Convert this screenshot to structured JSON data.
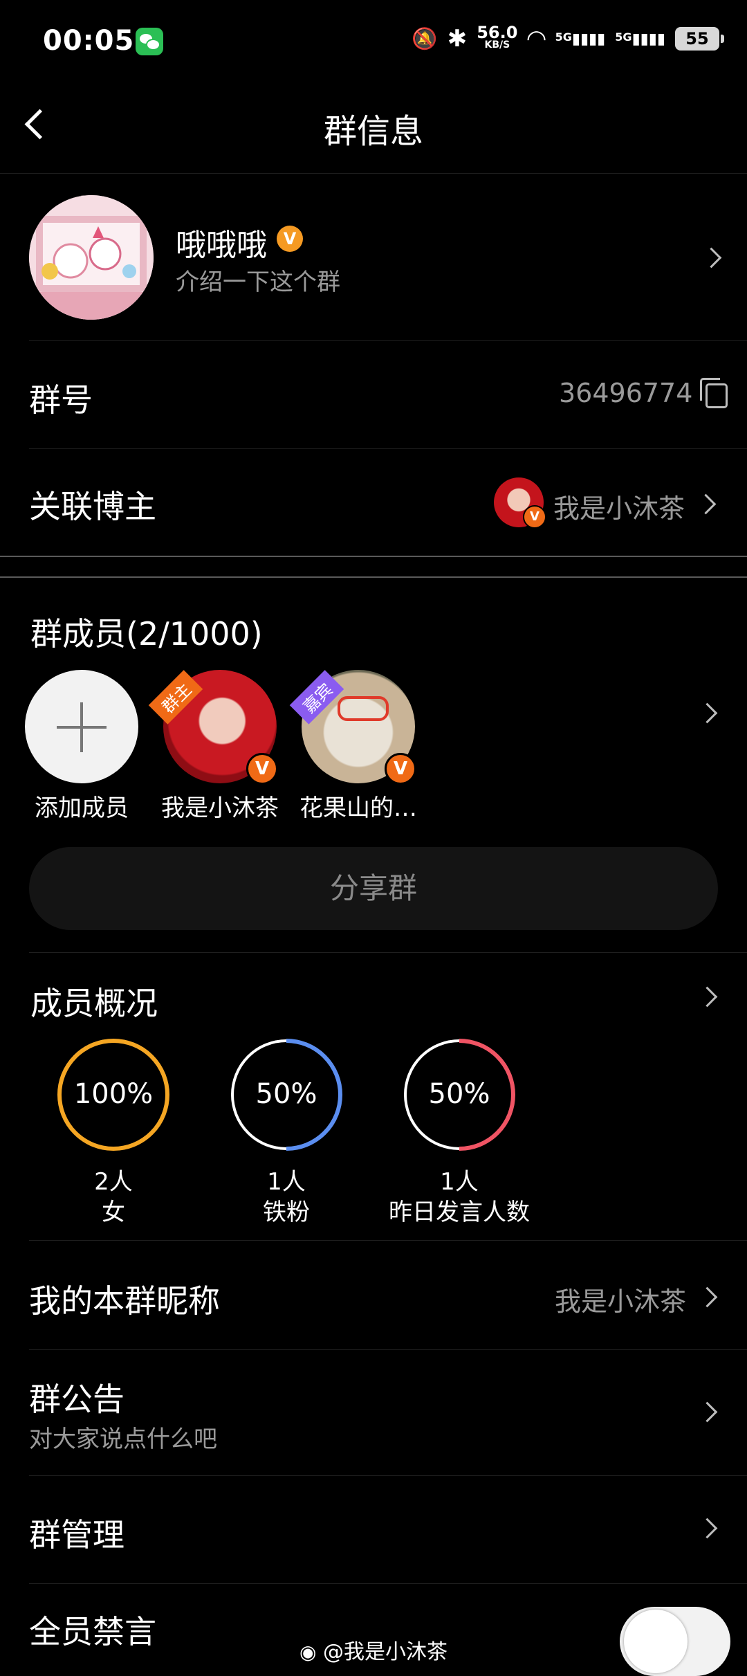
{
  "status": {
    "time": "00:05",
    "net_speed": "56.0",
    "net_unit": "KB/S",
    "sig1": "5G",
    "sig2": "5G",
    "battery": "55"
  },
  "nav": {
    "title": "群信息"
  },
  "group": {
    "name": "哦哦哦",
    "desc": "介绍一下这个群"
  },
  "rows": {
    "group_id_label": "群号",
    "group_id_value": "36496774",
    "blogger_label": "关联博主",
    "blogger_value": "我是小沐茶"
  },
  "members": {
    "title": "群成员(2/1000)",
    "add_label": "添加成员",
    "list": [
      {
        "name": "我是小沐茶",
        "tag": "群主"
      },
      {
        "name": "花果山的…",
        "tag": "嘉宾"
      }
    ],
    "share_label": "分享群"
  },
  "overview": {
    "title": "成员概况",
    "stats": [
      {
        "percent": "100%",
        "count": "2人",
        "label": "女",
        "fraction": 1.0,
        "color": "#f5a623"
      },
      {
        "percent": "50%",
        "count": "1人",
        "label": "铁粉",
        "fraction": 0.5,
        "color": "#5b8ef0"
      },
      {
        "percent": "50%",
        "count": "1人",
        "label": "昨日发言人数",
        "fraction": 0.5,
        "color": "#f05464"
      }
    ]
  },
  "settings": {
    "nickname_label": "我的本群昵称",
    "nickname_value": "我是小沐茶",
    "notice_label": "群公告",
    "notice_sub": "对大家说点什么吧",
    "manage_label": "群管理",
    "mute_label": "全员禁言"
  },
  "watermark": "@我是小沐茶"
}
